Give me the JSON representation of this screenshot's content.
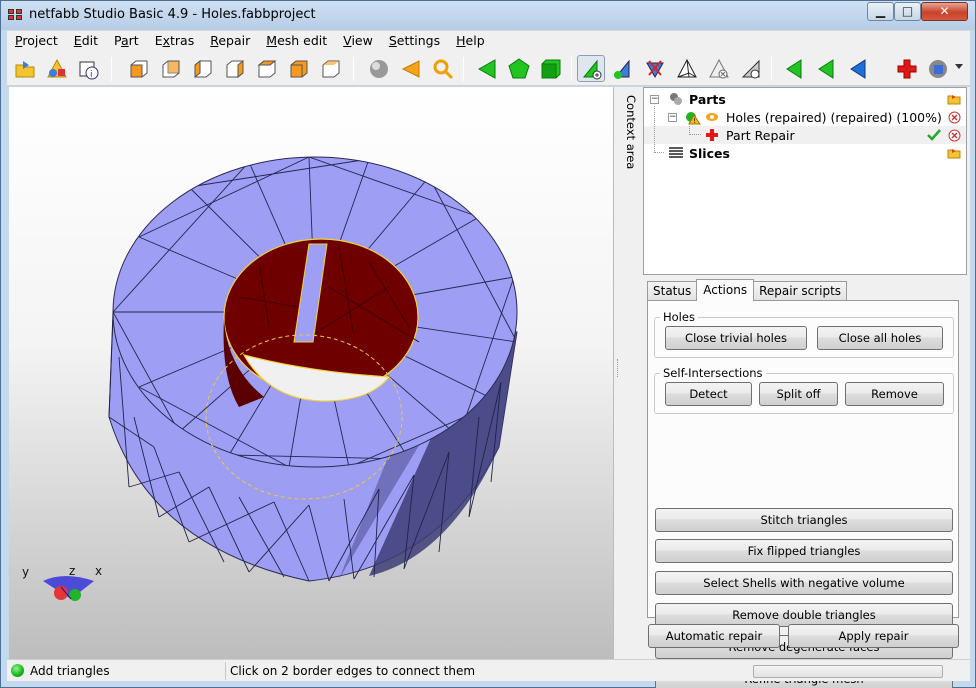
{
  "window": {
    "title": "netfabb Studio Basic 4.9 - Holes.fabbproject",
    "minimize": "▁",
    "maximize": "□",
    "close": "✕"
  },
  "menu": [
    {
      "pre": "",
      "ul": "P",
      "post": "roject"
    },
    {
      "pre": "",
      "ul": "E",
      "post": "dit"
    },
    {
      "pre": "P",
      "ul": "a",
      "post": "rt"
    },
    {
      "pre": "E",
      "ul": "x",
      "post": "tras"
    },
    {
      "pre": "",
      "ul": "R",
      "post": "epair"
    },
    {
      "pre": "",
      "ul": "M",
      "post": "esh edit"
    },
    {
      "pre": "",
      "ul": "V",
      "post": "iew"
    },
    {
      "pre": "",
      "ul": "S",
      "post": "ettings"
    },
    {
      "pre": "",
      "ul": "H",
      "post": "elp"
    }
  ],
  "toolbar_icons": [
    "open-project-icon",
    "add-part-icon",
    "part-info-icon",
    "view-front-icon",
    "view-back-icon",
    "view-left-icon",
    "view-right-icon",
    "view-top-icon",
    "view-bottom-icon",
    "view-iso-icon",
    "shading-icon",
    "select-triangle-icon",
    "zoom-icon",
    "select-triangles-icon",
    "select-surface-icon",
    "select-shell-icon",
    "add-triangles-icon",
    "add-point-icon",
    "cut-triangles-icon",
    "tetrahedron-icon",
    "remove-triangle-icon",
    "remove-surface-icon",
    "flip-left-icon",
    "flip-mid-icon",
    "flip-right-icon",
    "repair-cross-icon",
    "settings-dropdown-icon"
  ],
  "context_area_label": "Context area",
  "tree": {
    "parts_label": "Parts",
    "part_label": "Holes (repaired) (repaired) (100%)",
    "repair_label": "Part Repair",
    "slices_label": "Slices"
  },
  "tabs": [
    "Status",
    "Actions",
    "Repair scripts"
  ],
  "active_tab": "Actions",
  "actions": {
    "holes_group": "Holes",
    "close_trivial": "Close trivial holes",
    "close_all": "Close all holes",
    "self_intersections_group": "Self-Intersections",
    "detect": "Detect",
    "split_off": "Split off",
    "remove": "Remove",
    "stitch": "Stitch triangles",
    "fix_flipped": "Fix flipped triangles",
    "select_shells": "Select Shells with negative volume",
    "remove_double": "Remove double triangles",
    "remove_degenerate": "Remove degenerate faces",
    "refine": "Refine triangle mesh"
  },
  "bottom_buttons": {
    "automatic_repair": "Automatic repair",
    "apply_repair": "Apply repair"
  },
  "axes": {
    "y": "y",
    "z": "z",
    "x": "x"
  },
  "status": {
    "mode": "Add triangles",
    "hint": "Click on 2 border edges to connect them"
  },
  "colors": {
    "mesh_face": "#9e9ef5",
    "mesh_side": "#6d6dc4",
    "hole_interior": "#6b0000",
    "selection_edge": "#f2d23a"
  }
}
